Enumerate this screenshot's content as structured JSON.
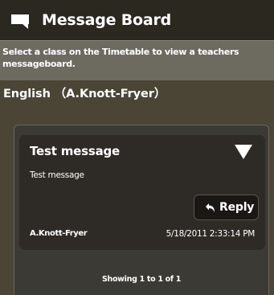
{
  "header": {
    "title": "Message Board",
    "icon": "message-icon"
  },
  "instructions": "Select a class on the Timetable to view a teachers messageboard.",
  "class_title": "English （A.Knott-Fryer）",
  "messages": [
    {
      "subject": "Test message",
      "body": "Test message",
      "reply_label": "Reply",
      "author": "A.Knott-Fryer",
      "date": "5/18/2011 2:33:14 PM"
    }
  ],
  "pagination": "Showing 1 to 1 of 1",
  "colors": {
    "header_bg": "#2b2820",
    "instructions_bg": "#6d6a60",
    "page_bg": "#4b4536",
    "panel_bg": "#3c3a34",
    "message_bg": "#2e2b26",
    "reply_bg": "#1a1814",
    "text": "#ffffff"
  }
}
